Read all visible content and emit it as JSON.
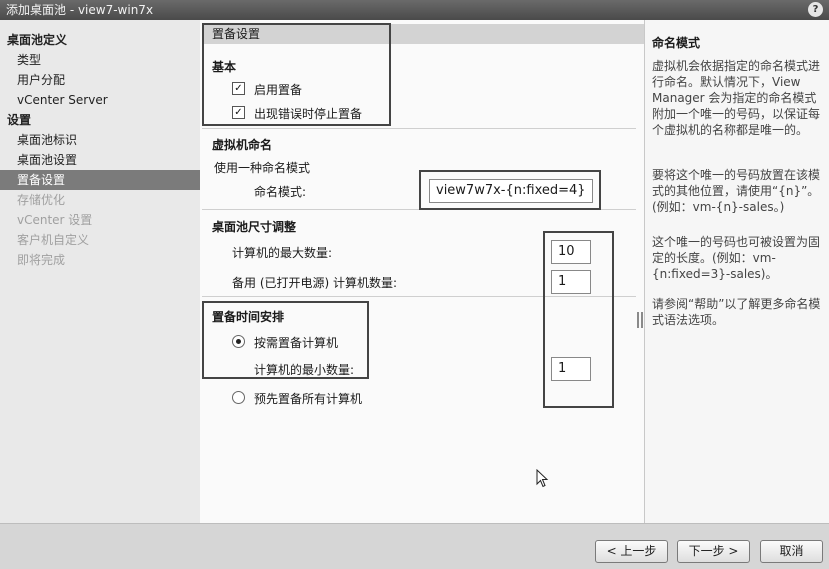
{
  "window": {
    "title": "添加桌面池 - view7-win7x",
    "help_label": "?"
  },
  "nav": {
    "items": [
      {
        "label": "桌面池定义",
        "kind": "section"
      },
      {
        "label": "类型",
        "kind": "item"
      },
      {
        "label": "用户分配",
        "kind": "item"
      },
      {
        "label": "vCenter Server",
        "kind": "item"
      },
      {
        "label": "设置",
        "kind": "section"
      },
      {
        "label": "桌面池标识",
        "kind": "item"
      },
      {
        "label": "桌面池设置",
        "kind": "item"
      },
      {
        "label": "置备设置",
        "kind": "active"
      },
      {
        "label": "存储优化",
        "kind": "disabled"
      },
      {
        "label": "vCenter 设置",
        "kind": "disabled"
      },
      {
        "label": "客户机自定义",
        "kind": "disabled"
      },
      {
        "label": "即将完成",
        "kind": "disabled"
      }
    ]
  },
  "main": {
    "section_title": "置备设置",
    "basic": {
      "heading": "基本",
      "enable_provisioning": {
        "label": "启用置备",
        "checked": true
      },
      "stop_on_error": {
        "label": "出现错误时停止置备",
        "checked": true
      }
    },
    "naming": {
      "heading": "虚拟机命名",
      "method_label": "使用一种命名模式",
      "pattern_label": "命名模式:",
      "pattern_value": "view7w7x-{n:fixed=4}"
    },
    "sizing": {
      "heading": "桌面池尺寸调整",
      "max_label": "计算机的最大数量:",
      "max_value": "10",
      "spare_label": "备用 (已打开电源) 计算机数量:",
      "spare_value": "1"
    },
    "timing": {
      "heading": "置备时间安排",
      "on_demand_label": "按需置备计算机",
      "min_label": "计算机的最小数量:",
      "min_value": "1",
      "all_upfront_label": "预先置备所有计算机",
      "selected": "on_demand"
    }
  },
  "help": {
    "title": "命名模式",
    "p1": "虚拟机会依据指定的命名模式进行命名。默认情况下，View Manager 会为指定的命名模式附加一个唯一的号码，以保证每个虚拟机的名称都是唯一的。",
    "p2": "要将这个唯一的号码放置在该模式的其他位置，请使用“{n}”。(例如：vm-{n}-sales。)",
    "p3": "这个唯一的号码也可被设置为固定的长度。(例如：vm-{n:fixed=3}-sales)。",
    "p4": "请参阅“帮助”以了解更多命名模式语法选项。"
  },
  "footer": {
    "back_label": "< 上一步",
    "next_label": "下一步 >",
    "cancel_label": "取消"
  }
}
